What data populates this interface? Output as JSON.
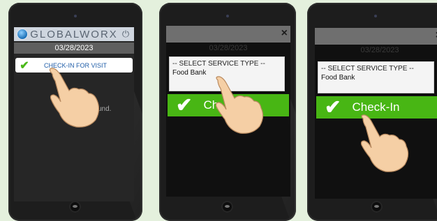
{
  "frames": [
    {
      "app_name": "GLOBALWORX",
      "date": "03/28/2023",
      "checkin_label": "CHECK-IN FOR VISIT",
      "faint_text": "und.",
      "icons": [
        "globe-icon",
        "power-icon",
        "checkmark-icon"
      ]
    },
    {
      "close": "×",
      "date": "03/28/2023",
      "dropdown_label": "-- SELECT SERVICE TYPE --",
      "dropdown_option": "Food Bank",
      "button_label": "Ch"
    },
    {
      "close": "×",
      "date": "03/28/2023",
      "dropdown_label": "-- SELECT SERVICE TYPE --",
      "dropdown_option": "Food Bank",
      "button_label": "Check-In"
    }
  ],
  "colors": {
    "background": "#e4f0dd",
    "accent_green": "#48b614",
    "label_blue": "#1f5da8",
    "device": "#1d1d1d"
  }
}
